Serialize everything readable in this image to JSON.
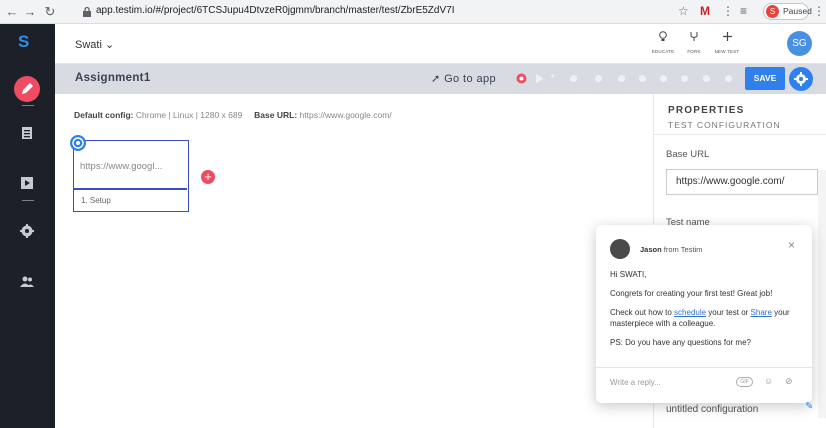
{
  "browser": {
    "url": "app.testim.io/#/project/6TCSJupu4DtvzeR0jgmm/branch/master/test/ZbrE5ZdV7I",
    "paused_label": "Paused",
    "profile_initial": "S"
  },
  "sidebar": {
    "logo": "S"
  },
  "appbar": {
    "project_name": "Swati",
    "project_caret": "⌄",
    "tools": [
      {
        "label": "EDUCATE"
      },
      {
        "label": "FORK"
      },
      {
        "label": "NEW TEST"
      }
    ],
    "avatar_initials": "SG"
  },
  "testbar": {
    "title": "Assignment1",
    "goto_label": "Go to app",
    "save_label": "SAVE"
  },
  "canvas": {
    "config_key": "Default config:",
    "config_value": "Chrome | Linux | 1280 x 689",
    "base_key": "Base URL:",
    "base_value": "https://www.google.com/",
    "step_url": "https://www.googl...",
    "step_name": "1. Setup",
    "add_step_label": "+"
  },
  "properties": {
    "title": "PROPERTIES",
    "subtitle": "TEST CONFIGURATION",
    "base_url_label": "Base URL",
    "base_url_value": "https://www.google.com/",
    "test_name_label": "Test name",
    "config_value": "untitled configuration"
  },
  "chat": {
    "from_name": "Jason",
    "from_suffix": "from Testim",
    "close_label": "×",
    "greeting": "Hi SWATI,",
    "line1": "Congrets for creating your first test! Great job!",
    "line2_a": "Check out how to ",
    "link_schedule": "schedule",
    "line2_b": " your test or ",
    "link_share": "Share",
    "line2_c": " your masterpiece with a colleague.",
    "line3": "PS: Do you have any questions for me?",
    "reply_placeholder": "Write a reply...",
    "gif_label": "GIF"
  },
  "colors": {
    "sidebar": "#1c2029",
    "accent": "#2f80ed",
    "record": "#ef4c63"
  }
}
